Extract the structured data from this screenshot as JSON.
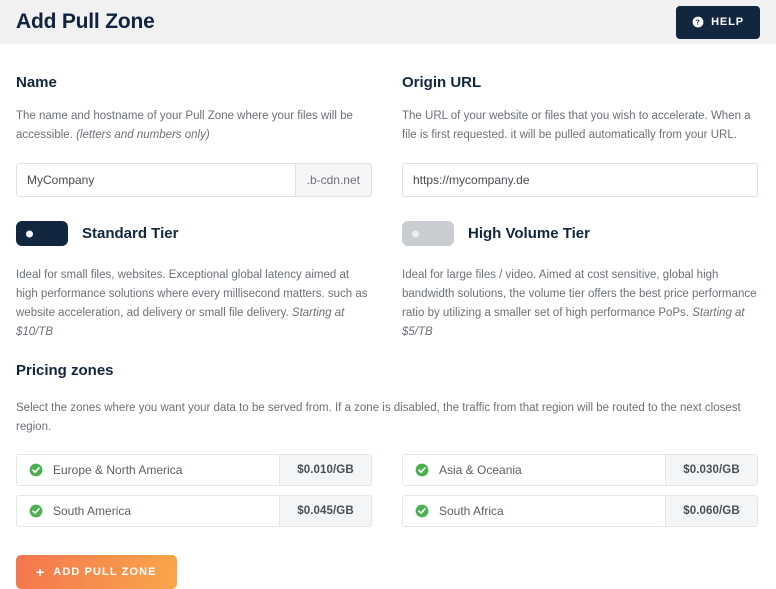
{
  "header": {
    "title": "Add Pull Zone",
    "help_label": "HELP",
    "help_icon": "question-circle-icon"
  },
  "name_section": {
    "title": "Name",
    "description": "The name and hostname of your Pull Zone where your files will be accessible. ",
    "description_em": "(letters and numbers only)",
    "value": "MyCompany",
    "placeholder": "MyCompany",
    "suffix": ".b-cdn.net"
  },
  "origin_section": {
    "title": "Origin URL",
    "description": "The URL of your website or files that you wish to accelerate. When a file is first requested. it will be pulled automatically from your URL.",
    "value": "https://mycompany.de",
    "placeholder": "https://mycompany.de"
  },
  "tiers": [
    {
      "label": "Standard Tier",
      "state": "on",
      "description": "Ideal for small files, websites. Exceptional global latency aimed at high performance solutions where every millisecond matters. such as website acceleration, ad delivery or small file delivery. ",
      "description_em": "Starting at $10/TB"
    },
    {
      "label": "High Volume Tier",
      "state": "off",
      "description": "Ideal for large files / video. Aimed at cost sensitive, global high bandwidth solutions, the volume tier offers the best price performance ratio by utilizing a smaller set of high performance PoPs. ",
      "description_em": "Starting at $5/TB"
    }
  ],
  "pricing": {
    "title": "Pricing zones",
    "description": "Select the zones where you want your data to be served from. If a zone is disabled, the traffic from that region will be routed to the next closest region.",
    "zones_left": [
      {
        "name": "Europe & North America",
        "price": "$0.010/GB",
        "enabled": true
      },
      {
        "name": "South America",
        "price": "$0.045/GB",
        "enabled": true
      }
    ],
    "zones_right": [
      {
        "name": "Asia & Oceania",
        "price": "$0.030/GB",
        "enabled": true
      },
      {
        "name": "South Africa",
        "price": "$0.060/GB",
        "enabled": true
      }
    ]
  },
  "submit": {
    "label": "ADD PULL ZONE",
    "plus": "+"
  },
  "colors": {
    "header_bg": "#f1f1f1",
    "navy": "#12263f",
    "green": "#4caf50",
    "orange_start": "#f4764f",
    "orange_end": "#f9a64a",
    "toggle_off": "#c9ccd0"
  }
}
